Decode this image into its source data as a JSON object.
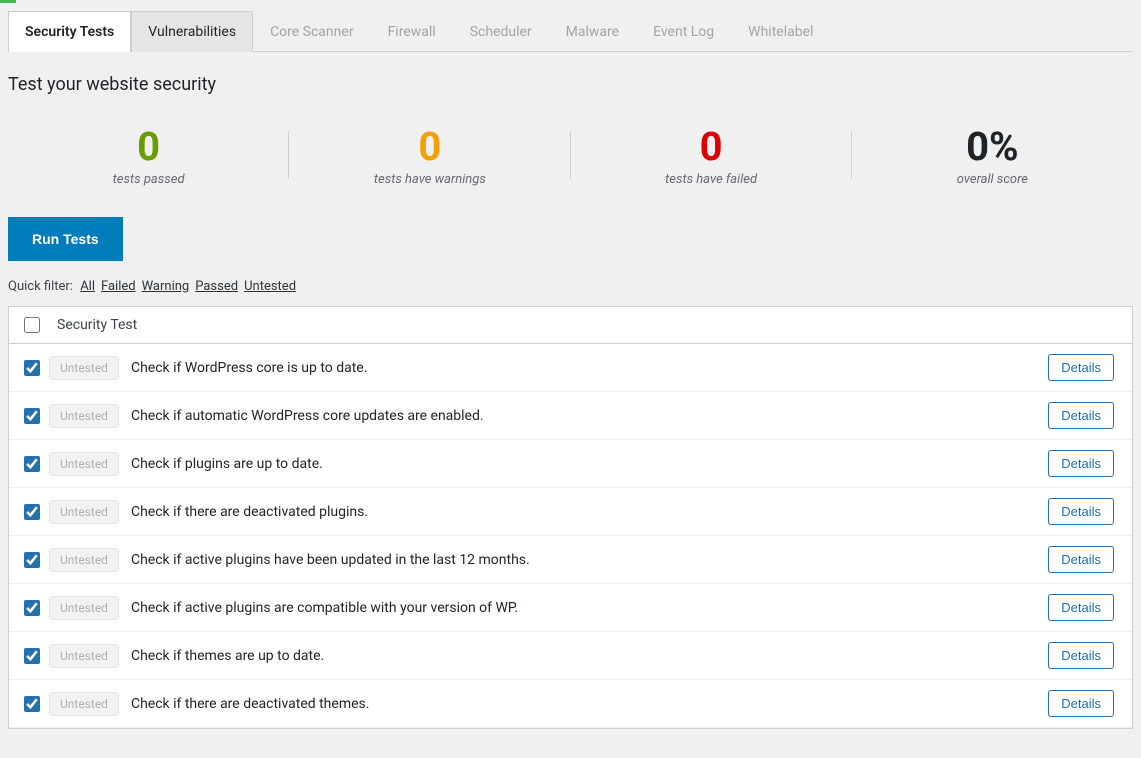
{
  "tabs": [
    {
      "label": "Security Tests",
      "state": "active"
    },
    {
      "label": "Vulnerabilities",
      "state": "enabled"
    },
    {
      "label": "Core Scanner",
      "state": "disabled"
    },
    {
      "label": "Firewall",
      "state": "disabled"
    },
    {
      "label": "Scheduler",
      "state": "disabled"
    },
    {
      "label": "Malware",
      "state": "disabled"
    },
    {
      "label": "Event Log",
      "state": "disabled"
    },
    {
      "label": "Whitelabel",
      "state": "disabled"
    }
  ],
  "heading": "Test your website security",
  "stats": {
    "passed": {
      "value": "0",
      "label": "tests passed"
    },
    "warnings": {
      "value": "0",
      "label": "tests have warnings"
    },
    "failed": {
      "value": "0",
      "label": "tests have failed"
    },
    "score": {
      "value": "0%",
      "label": "overall score"
    }
  },
  "run_button": "Run Tests",
  "filter": {
    "label": "Quick filter:",
    "options": [
      "All",
      "Failed",
      "Warning",
      "Passed",
      "Untested"
    ]
  },
  "table": {
    "header": "Security Test",
    "details_label": "Details",
    "badge_label": "Untested",
    "rows": [
      "Check if WordPress core is up to date.",
      "Check if automatic WordPress core updates are enabled.",
      "Check if plugins are up to date.",
      "Check if there are deactivated plugins.",
      "Check if active plugins have been updated in the last 12 months.",
      "Check if active plugins are compatible with your version of WP.",
      "Check if themes are up to date.",
      "Check if there are deactivated themes."
    ]
  }
}
